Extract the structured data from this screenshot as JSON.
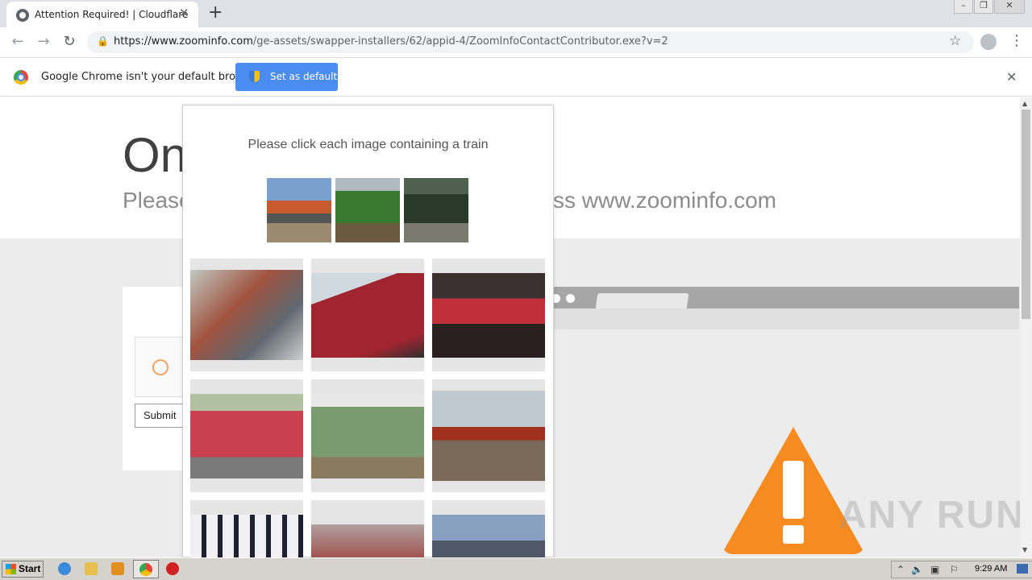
{
  "browser": {
    "tab_title": "Attention Required! | Cloudflare",
    "tab_close": "✕",
    "new_tab": "+",
    "window_controls": {
      "minimize": "–",
      "restore": "❐",
      "close": "✕"
    },
    "url_host": "https://www.zoominfo.com",
    "url_path": "/ge-assets/swapper-installers/62/appid-4/ZoomInfoContactContributor.exe?v=2",
    "icons": {
      "back": "back-arrow-icon",
      "forward": "forward-arrow-icon",
      "reload": "reload-icon",
      "lock": "lock-icon",
      "star": "star-icon",
      "profile": "profile-icon",
      "menu": "kebab-menu-icon"
    }
  },
  "infobar": {
    "message": "Google Chrome isn't your default browser",
    "button": "Set as default",
    "close": "✕"
  },
  "page": {
    "heading_partial": "On",
    "sub_left": "Please",
    "sub_right": "ss www.zoominfo.com",
    "submit_label": "Submit",
    "watermark": "ANY RUN"
  },
  "captcha": {
    "prompt": "Please click each image containing a train",
    "samples": [
      "train-sample-1",
      "train-sample-2",
      "train-sample-3"
    ],
    "grid": [
      {
        "name": "bus-street",
        "color": "#a0533f"
      },
      {
        "name": "red-car-closeup",
        "color": "#a02530"
      },
      {
        "name": "red-train-station",
        "color": "#2a2020"
      },
      {
        "name": "red-hatchback",
        "color": "#c94050"
      },
      {
        "name": "green-train",
        "color": "#7a9a70"
      },
      {
        "name": "freight-train",
        "color": "#7a6a5a"
      },
      {
        "name": "airplane-windows",
        "color": "#e6e6ee"
      },
      {
        "name": "blurred-scene",
        "color": "#a05550"
      },
      {
        "name": "aircraft-sky",
        "color": "#8aa0c0"
      }
    ]
  },
  "taskbar": {
    "start": "Start",
    "clock": "9:29 AM"
  },
  "colors": {
    "accent": "#4a8cf0",
    "warning": "#f68b1f"
  }
}
